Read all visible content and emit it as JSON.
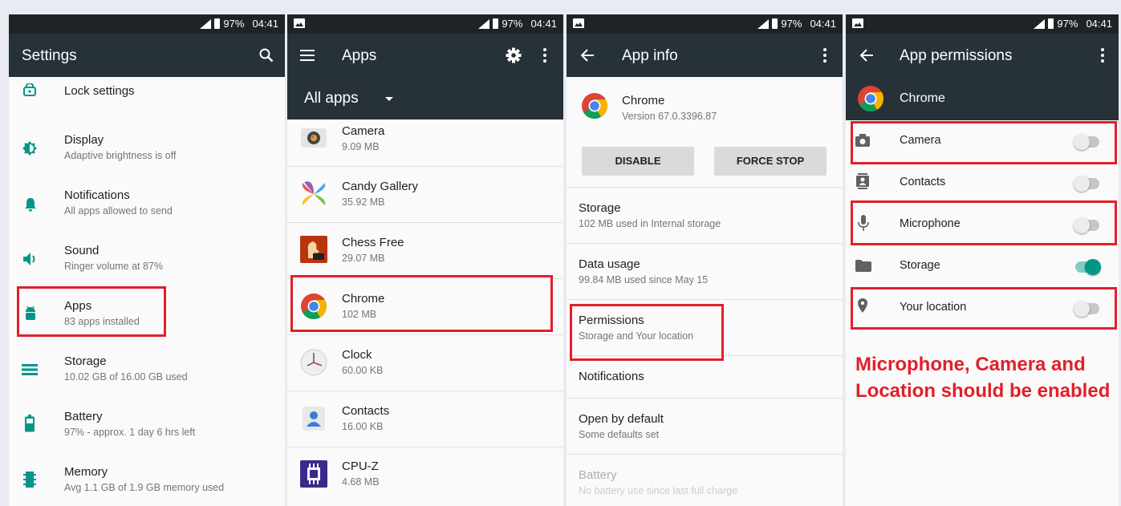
{
  "status_bar": {
    "battery": "97%",
    "time": "04:41"
  },
  "colors": {
    "appbar": "#263238",
    "accent": "#009688",
    "highlight": "#e0202a"
  },
  "settings": {
    "title": "Settings",
    "items": [
      {
        "title": "Lock settings",
        "subtitle": "",
        "icon": "lock-icon"
      },
      {
        "title": "Display",
        "subtitle": "Adaptive brightness is off",
        "icon": "brightness-icon"
      },
      {
        "title": "Notifications",
        "subtitle": "All apps allowed to send",
        "icon": "bell-icon"
      },
      {
        "title": "Sound",
        "subtitle": "Ringer volume at 87%",
        "icon": "volume-icon"
      },
      {
        "title": "Apps",
        "subtitle": "83 apps installed",
        "icon": "android-icon"
      },
      {
        "title": "Storage",
        "subtitle": "10.02 GB of 16.00 GB used",
        "icon": "storage-icon"
      },
      {
        "title": "Battery",
        "subtitle": "97% - approx. 1 day 6 hrs left",
        "icon": "battery-icon"
      },
      {
        "title": "Memory",
        "subtitle": "Avg 1.1 GB of 1.9 GB memory used",
        "icon": "memory-icon"
      }
    ]
  },
  "apps": {
    "title": "Apps",
    "filter": "All apps",
    "items": [
      {
        "name": "Camera",
        "size": "9.09 MB",
        "icon": "camera-app-icon"
      },
      {
        "name": "Candy Gallery",
        "size": "35.92 MB",
        "icon": "candy-gallery-icon"
      },
      {
        "name": "Chess Free",
        "size": "29.07 MB",
        "icon": "chess-icon"
      },
      {
        "name": "Chrome",
        "size": "102 MB",
        "icon": "chrome-icon"
      },
      {
        "name": "Clock",
        "size": "60.00 KB",
        "icon": "clock-icon"
      },
      {
        "name": "Contacts",
        "size": "16.00 KB",
        "icon": "contacts-app-icon"
      },
      {
        "name": "CPU-Z",
        "size": "4.68 MB",
        "icon": "cpu-z-icon"
      }
    ]
  },
  "app_info": {
    "title": "App info",
    "app_name": "Chrome",
    "version": "Version 67.0.3396.87",
    "disable_label": "DISABLE",
    "force_stop_label": "FORCE STOP",
    "items": [
      {
        "title": "Storage",
        "subtitle": "102 MB used in Internal storage"
      },
      {
        "title": "Data usage",
        "subtitle": "99.84 MB used since May 15"
      },
      {
        "title": "Permissions",
        "subtitle": "Storage and Your location"
      },
      {
        "title": "Notifications",
        "subtitle": ""
      },
      {
        "title": "Open by default",
        "subtitle": "Some defaults set"
      },
      {
        "title": "Battery",
        "subtitle": "No battery use since last full charge"
      }
    ]
  },
  "permissions": {
    "title": "App permissions",
    "app_name": "Chrome",
    "items": [
      {
        "label": "Camera",
        "enabled": false,
        "icon": "camera-icon"
      },
      {
        "label": "Contacts",
        "enabled": false,
        "icon": "contacts-icon"
      },
      {
        "label": "Microphone",
        "enabled": false,
        "icon": "microphone-icon"
      },
      {
        "label": "Storage",
        "enabled": true,
        "icon": "folder-icon"
      },
      {
        "label": "Your location",
        "enabled": false,
        "icon": "location-icon"
      }
    ],
    "note": "Microphone, Camera and Location should be enabled"
  }
}
